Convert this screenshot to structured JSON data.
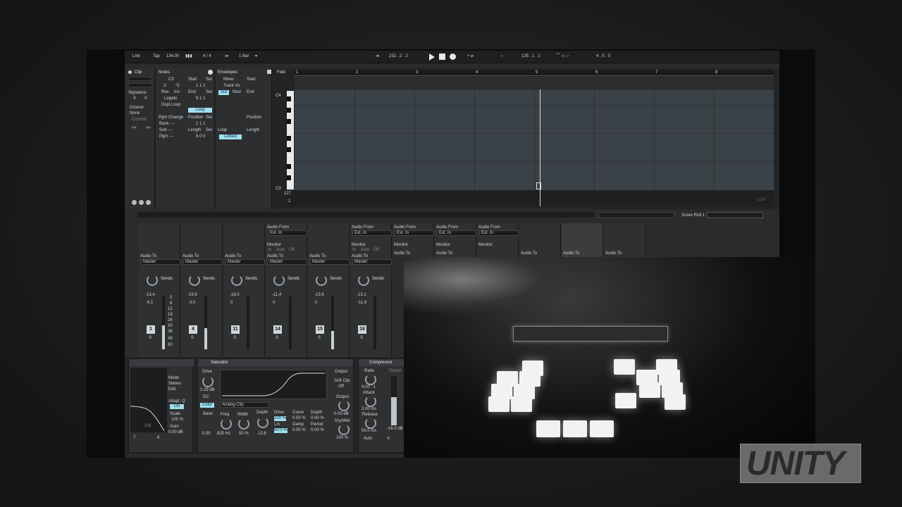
{
  "transport": {
    "link": "Link",
    "tap": "Tap",
    "tempo": "134.00",
    "signature": "4 / 4",
    "quantize": "1 Bar",
    "position": "232 .  2 .  2",
    "loop_start": "135 .  1 .  1",
    "loop_length": "4 .  0 .  0"
  },
  "clip_panel": {
    "clip": "Clip",
    "notes": "Notes",
    "envelopes": "Envelopes",
    "signature": "Signature",
    "sig_num": "4",
    "sig_den": "4",
    "groove": "Groove",
    "none": "None",
    "commit": "Commit",
    "nav_prev": "<<",
    "nav_next": ">>",
    "note_c3": "C3",
    "half": ":2",
    "double": "*2",
    "rev": "Rev",
    "inv": "Inv",
    "legato": "Legato",
    "dupl_loop": "Dupl.Loop",
    "pgm_change": "Pgm Change",
    "bank": "Bank ---",
    "sub": "Sub ---",
    "pgm": "Pgm ---",
    "start": "Start",
    "set": "Set",
    "start_val": "1   1   1",
    "end": "End",
    "end_val": "9   1   1",
    "loop": "Loop",
    "position": "Position",
    "position_val": "1   1   1",
    "length": "Length",
    "length_val": "8   0   0",
    "mixer": "Mixer",
    "track_vol": "Track Vo",
    "aut": "Aut",
    "mod": "Mod",
    "linked": "Linked",
    "env_start": "Start",
    "env_end": "End",
    "env_position": "Position",
    "env_length": "Length",
    "env_loop": "Loop"
  },
  "editor": {
    "fold": "Fold",
    "bars": [
      "1",
      "2",
      "3",
      "4",
      "5",
      "6",
      "7",
      "8"
    ],
    "key_c4": "C4",
    "key_c3": "C3",
    "velocity": "127",
    "velocity_low": "1",
    "grid_quant": "1/16",
    "clip_name": "Snare Roll 1"
  },
  "mixer": {
    "strips": [
      {
        "audio_to": "Audio To",
        "dest": "Master",
        "vol": "-13.4",
        "pan": "-6.1",
        "num": "1",
        "level": 0.45
      },
      {
        "audio_to": "Audio To",
        "dest": "Master",
        "vol": "-19.9",
        "pan": "-3.0",
        "num": "4",
        "level": 0.4
      },
      {
        "audio_to": "Audio To",
        "dest": "Master",
        "vol": "-19.0",
        "pan": "0",
        "num": "11",
        "level": 0.0
      },
      {
        "audio_to": "Audio To",
        "dest": "Master",
        "vol": "-11.4",
        "pan": "0",
        "num": "14",
        "level": 0.0
      },
      {
        "audio_to": "Audio To",
        "dest": "Master",
        "vol": "-13.6",
        "pan": "0",
        "num": "15",
        "level": 0.35
      },
      {
        "audio_to": "Audio To",
        "dest": "Master",
        "vol": "-13.1",
        "pan": "-11.9",
        "num": "16",
        "level": 0.0
      }
    ],
    "audio_from": "Audio From",
    "ext_in": "Ext. In",
    "monitor": "Monitor",
    "mon_in": "In",
    "mon_auto": "Auto",
    "mon_off": "Off",
    "sends": "Sends",
    "scale": [
      "0",
      "6",
      "12",
      "18",
      "24",
      "30",
      "36",
      "48",
      "60"
    ],
    "solo": "S",
    "extra_audio_to": [
      "Audio To",
      "Audio To",
      "Audio To",
      "Audio To",
      "Audio To"
    ],
    "mas_dest": "Mas"
  },
  "devices": {
    "eq": {
      "mode": "Mode",
      "stereo": "Stereo",
      "edit": "Edit",
      "adapt_q": "Adapt. Q",
      "on": "On",
      "scale": "Scale",
      "scale_val": "100 %",
      "gain": "Gain",
      "gain_val": "0.00 dB",
      "freq_label": "10k",
      "band_a": "7",
      "band_b": "8"
    },
    "saturator": {
      "title": "Saturator",
      "drive": "Drive",
      "drive_val": "2.29 dB",
      "dc": "DC",
      "color": "Color",
      "type": "Analog Clip",
      "base": "Base",
      "base_val": "0.00",
      "freq": "Freq",
      "freq_val": "825 Hz",
      "width": "Width",
      "width_val": "50 %",
      "depth": "Depth",
      "depth_val": "12.6",
      "drive2": "Drive",
      "drive2_val": "100 %",
      "lin": "Lin",
      "lin_val": "50.0 %",
      "curve": "Curve",
      "curve_val": "0.00 %",
      "damp": "Damp",
      "damp_val": "0.00 %",
      "depth2": "Depth",
      "depth2_val": "0.00 %",
      "period": "Period",
      "period_val": "0.00 %",
      "output": "Output",
      "soft_clip": "Soft Clip",
      "off": "Off",
      "output2": "Output",
      "output_val": "0.00 dB",
      "drywet": "Dry/Wet",
      "drywet_val": "100 %"
    },
    "compressor": {
      "title": "Compressor",
      "ratio": "Ratio",
      "ratio_val": "4.00 : 1",
      "attack": "Attack",
      "attack_val": "2.00 ms",
      "release": "Release",
      "release_val": "50.0 ms",
      "auto": "Auto",
      "thresh": "Thresh",
      "thresh_val": "-16.0 dB",
      "a_btn": "A"
    }
  },
  "overlay": {
    "logo": "UNITY"
  },
  "colors": {
    "accent": "#9fdff0",
    "pad_lit": "#f1f2f2",
    "background": "#2a2b2d"
  }
}
